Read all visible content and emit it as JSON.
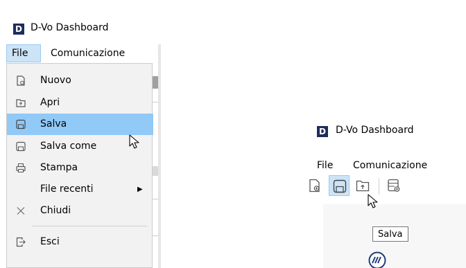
{
  "app": {
    "title": "D-Vo Dashboard",
    "icon_letter": "D"
  },
  "menubar": {
    "file": "File",
    "communication": "Comunicazione"
  },
  "file_menu": {
    "items": [
      {
        "label": "Nuovo",
        "icon": "new-file-icon"
      },
      {
        "label": "Apri",
        "icon": "open-folder-icon"
      },
      {
        "label": "Salva",
        "icon": "save-icon",
        "highlighted": true
      },
      {
        "label": "Salva come",
        "icon": "save-as-icon"
      },
      {
        "label": "Stampa",
        "icon": "print-icon"
      },
      {
        "label": "File recenti",
        "icon": "",
        "submenu_arrow": "▶"
      },
      {
        "label": "Chiudi",
        "icon": "close-icon"
      },
      {
        "label": "Esci",
        "icon": "exit-icon"
      }
    ]
  },
  "toolbar": {
    "buttons": [
      "new-file-icon",
      "save-icon",
      "open-folder-icon",
      "new-dashboard-icon"
    ],
    "hovered": "save-icon",
    "tooltip": "Salva"
  },
  "colors": {
    "highlight": "#91c9f7",
    "hover": "#cde4f7",
    "icon_bg": "#1f2d5c"
  }
}
